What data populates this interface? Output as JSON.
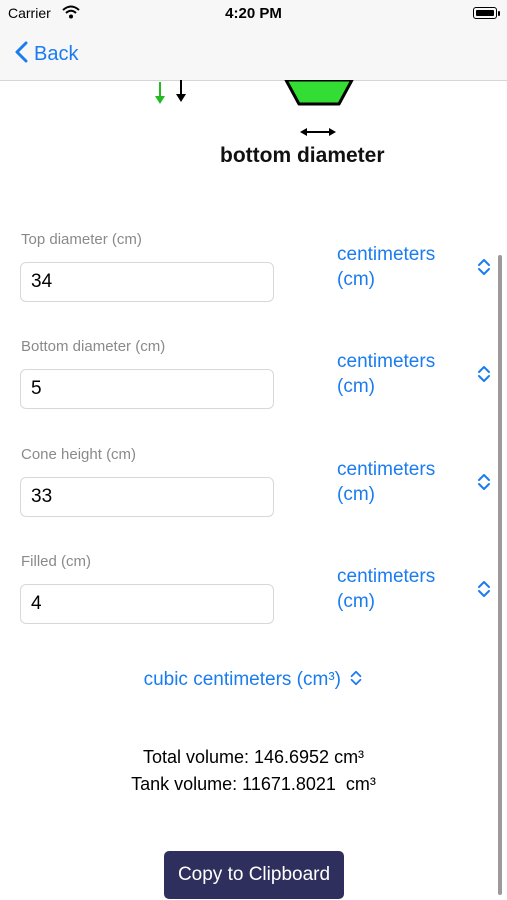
{
  "status_bar": {
    "carrier": "Carrier",
    "time": "4:20 PM"
  },
  "nav": {
    "back_label": "Back"
  },
  "diagram": {
    "bottom_label": "bottom diameter",
    "fill_color": "#33dd33"
  },
  "fields": [
    {
      "label": "Top diameter (cm)",
      "value": "34",
      "unit": "centimeters (cm)"
    },
    {
      "label": "Bottom diameter (cm)",
      "value": "5",
      "unit": "centimeters (cm)"
    },
    {
      "label": "Cone height (cm)",
      "value": "33",
      "unit": "centimeters (cm)"
    },
    {
      "label": "Filled (cm)",
      "value": "4",
      "unit": "centimeters (cm)"
    }
  ],
  "volume_unit": "cubic centimeters (cm³)",
  "results": {
    "total": "Total volume: 146.6952 cm³",
    "tank": "Tank volume: 11671.8021  cm³"
  },
  "copy_button": "Copy to Clipboard",
  "colors": {
    "accent": "#1a7cf0",
    "button": "#2f2f5e"
  }
}
